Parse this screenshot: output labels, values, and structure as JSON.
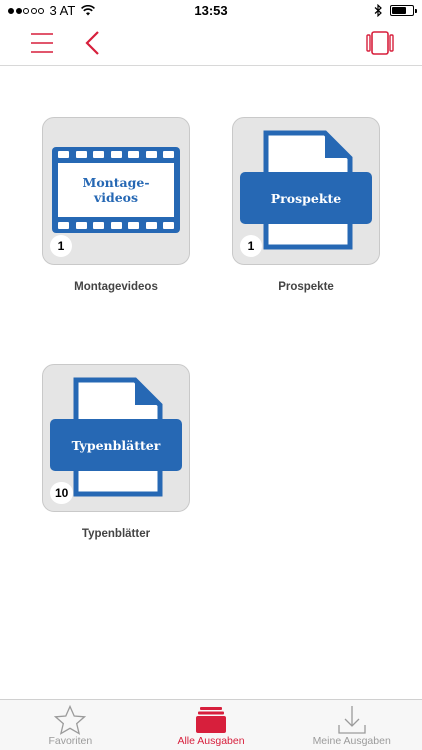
{
  "status_bar": {
    "carrier": "3 AT",
    "time": "13:53"
  },
  "colors": {
    "accent": "#d71f3c",
    "icon_blue": "#2668b4",
    "tile_bg": "#e5e5e5"
  },
  "nav": {
    "icons": [
      "menu-icon",
      "back-chevron-icon",
      "view-switch-icon"
    ]
  },
  "categories": [
    {
      "name": "Montagevideos",
      "icon_text": "Montage-\nvideos",
      "count": "1",
      "icon": "film-icon"
    },
    {
      "name": "Prospekte",
      "icon_text": "Prospekte",
      "count": "1",
      "icon": "document-icon"
    },
    {
      "name": "Typenblätter",
      "icon_text": "Typenblätter",
      "count": "10",
      "icon": "document-icon"
    }
  ],
  "tab_bar": {
    "tabs": [
      {
        "label": "Favoriten",
        "icon": "star-icon",
        "active": false
      },
      {
        "label": "Alle Ausgaben",
        "icon": "stack-icon",
        "active": true
      },
      {
        "label": "Meine Ausgaben",
        "icon": "download-icon",
        "active": false
      }
    ]
  }
}
